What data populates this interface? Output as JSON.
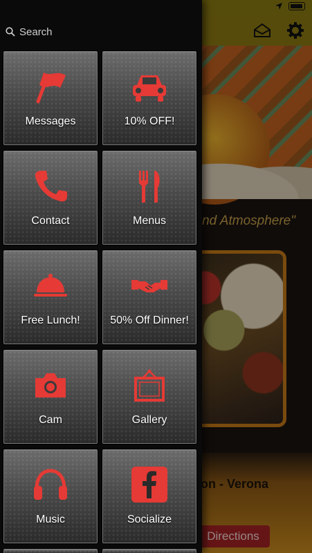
{
  "search": {
    "label": "Search"
  },
  "tiles": [
    {
      "label": "Messages",
      "icon": "flag-icon"
    },
    {
      "label": "10% OFF!",
      "icon": "car-icon"
    },
    {
      "label": "Contact",
      "icon": "phone-icon"
    },
    {
      "label": "Menus",
      "icon": "fork-knife-icon"
    },
    {
      "label": "Free Lunch!",
      "icon": "serving-cloche-icon"
    },
    {
      "label": "50% Off Dinner!",
      "icon": "handshake-icon"
    },
    {
      "label": "Cam",
      "icon": "camera-icon"
    },
    {
      "label": "Gallery",
      "icon": "picture-frame-icon"
    },
    {
      "label": "Music",
      "icon": "headphones-icon"
    },
    {
      "label": "Socialize",
      "icon": "facebook-icon"
    }
  ],
  "background_app": {
    "tagline": "und Atmosphere\"",
    "location": "on - Verona",
    "directions_label": "Directions"
  },
  "colors": {
    "accent_red": "#e53a35",
    "drawer_bg": "#0a0a0a",
    "appbar": "#8c7a12"
  }
}
